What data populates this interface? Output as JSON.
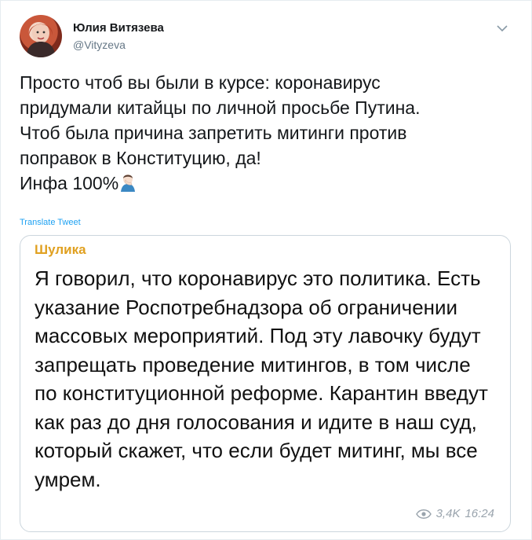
{
  "author": {
    "display_name": "Юлия Витязева",
    "handle": "@Vityzeva"
  },
  "icons": {
    "avatar": "avatar-photo",
    "chevron": "chevron-down-icon",
    "emoji": "person-facepalming-emoji",
    "views": "eye-icon"
  },
  "tweet": {
    "text": "Просто чтоб вы были в курсе: коронавирус\nпридумали китайцы по личной просьбе Путина.\nЧтоб была причина запретить митинги против\nпоправок в Конституцию, да!\nИнфа 100%",
    "translate_label": "Translate Tweet"
  },
  "quote": {
    "author": "Шулика",
    "text": "Я говорил, что коронавирус это политика. Есть указание Роспотребнадзора об ограничении массовых мероприятий. Под эту лавочку будут запрещать проведение митингов, в том числе по конституционной реформе. Карантин введут как раз до дня голосования и идите в наш суд, который скажет, что если будет митинг, мы все умрем.",
    "views": "3,4K",
    "time": "16:24"
  },
  "colors": {
    "link": "#1da1f2",
    "quote_author": "#e0a020",
    "muted": "#657786"
  }
}
